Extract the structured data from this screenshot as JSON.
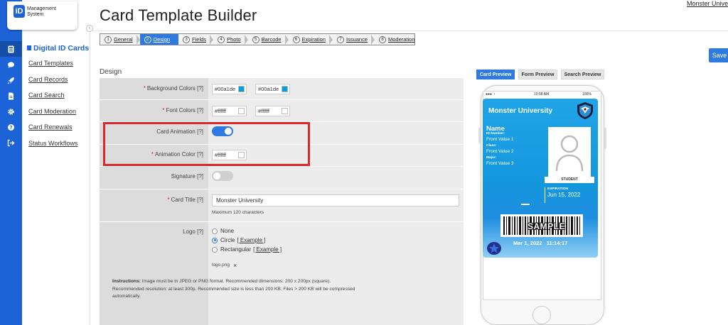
{
  "app": {
    "logo_mark": "iD",
    "logo_line1": "Management",
    "logo_line2": "System",
    "page_title": "Card Template Builder",
    "org_link": "Monster University",
    "save_label": "Save"
  },
  "sidebar": {
    "heading": "Digital ID Cards",
    "items": [
      {
        "label": "Card Templates"
      },
      {
        "label": "Card Records"
      },
      {
        "label": "Card Search"
      },
      {
        "label": "Card Moderation"
      },
      {
        "label": "Card Renewals"
      },
      {
        "label": "Status Workflows"
      }
    ],
    "rail_icons": [
      "id-card-icon",
      "chat-icon",
      "rocket-icon",
      "document-icon",
      "gear-icon",
      "help-icon",
      "logout-icon"
    ]
  },
  "wizard": {
    "steps": [
      {
        "num": "1",
        "label": "General"
      },
      {
        "num": "2",
        "label": "Design"
      },
      {
        "num": "3",
        "label": "Fields"
      },
      {
        "num": "4",
        "label": "Photo"
      },
      {
        "num": "5",
        "label": "Barcode"
      },
      {
        "num": "6",
        "label": "Expiration"
      },
      {
        "num": "7",
        "label": "Issuance"
      },
      {
        "num": "8",
        "label": "Moderation"
      }
    ],
    "active": "Design"
  },
  "form": {
    "section": "Design",
    "background_colors": {
      "label": "Background Colors [?]",
      "value1": "#00a1de",
      "value2": "#00a1de",
      "swatch": "#00a1de"
    },
    "font_colors": {
      "label": "Font Colors [?]",
      "value1": "#ffffff",
      "value2": "#ffffff",
      "swatch": "#ffffff"
    },
    "card_animation": {
      "label": "Card Animation [?]",
      "enabled": true
    },
    "animation_color": {
      "label": "Animation Color [?]",
      "value": "#ffffff"
    },
    "signature": {
      "label": "Signature [?]",
      "enabled": false
    },
    "card_title": {
      "label": "Card Title [?]",
      "value": "Monster University",
      "helper": "Maximum 120 characters"
    },
    "logo": {
      "label": "Logo [?]",
      "options": [
        {
          "label": "None",
          "example": ""
        },
        {
          "label": "Circle",
          "example": "[ Example ]"
        },
        {
          "label": "Rectangular",
          "example": "[ Example ]"
        }
      ],
      "selected": "Circle",
      "file_name": "logo.png",
      "remove_glyph": "×",
      "instructions_label": "Instructions:",
      "instructions_text": "Image must be in JPEG or PNG format. Recommended dimensions: 200 x 200px (square). Recommended resolution: at least 300p. Recommended size is less than 200 KB. Files > 200 KB will be compressed automatically."
    },
    "required_mark": "*"
  },
  "preview": {
    "tabs": [
      "Card Preview",
      "Form Preview",
      "Search Preview"
    ],
    "active_tab": "Card Preview",
    "status_time": "10:58 AM",
    "status_battery": "100%",
    "card": {
      "title": "Monster University",
      "name": "Name",
      "id_label": "ID Number:",
      "id_value": "Front Value 1",
      "class_label": "Class:",
      "class_value": "Front Value 2",
      "major_label": "Major:",
      "major_value": "Front Value 3",
      "status": "STUDENT",
      "exp_label": "EXPIRATION",
      "exp_value": "Jun 15, 2022",
      "watermark": "SAMPLE",
      "stamp_date": "Mar 1, 2022",
      "stamp_time": "11:14:17",
      "bg_color": "#1496dc"
    }
  }
}
